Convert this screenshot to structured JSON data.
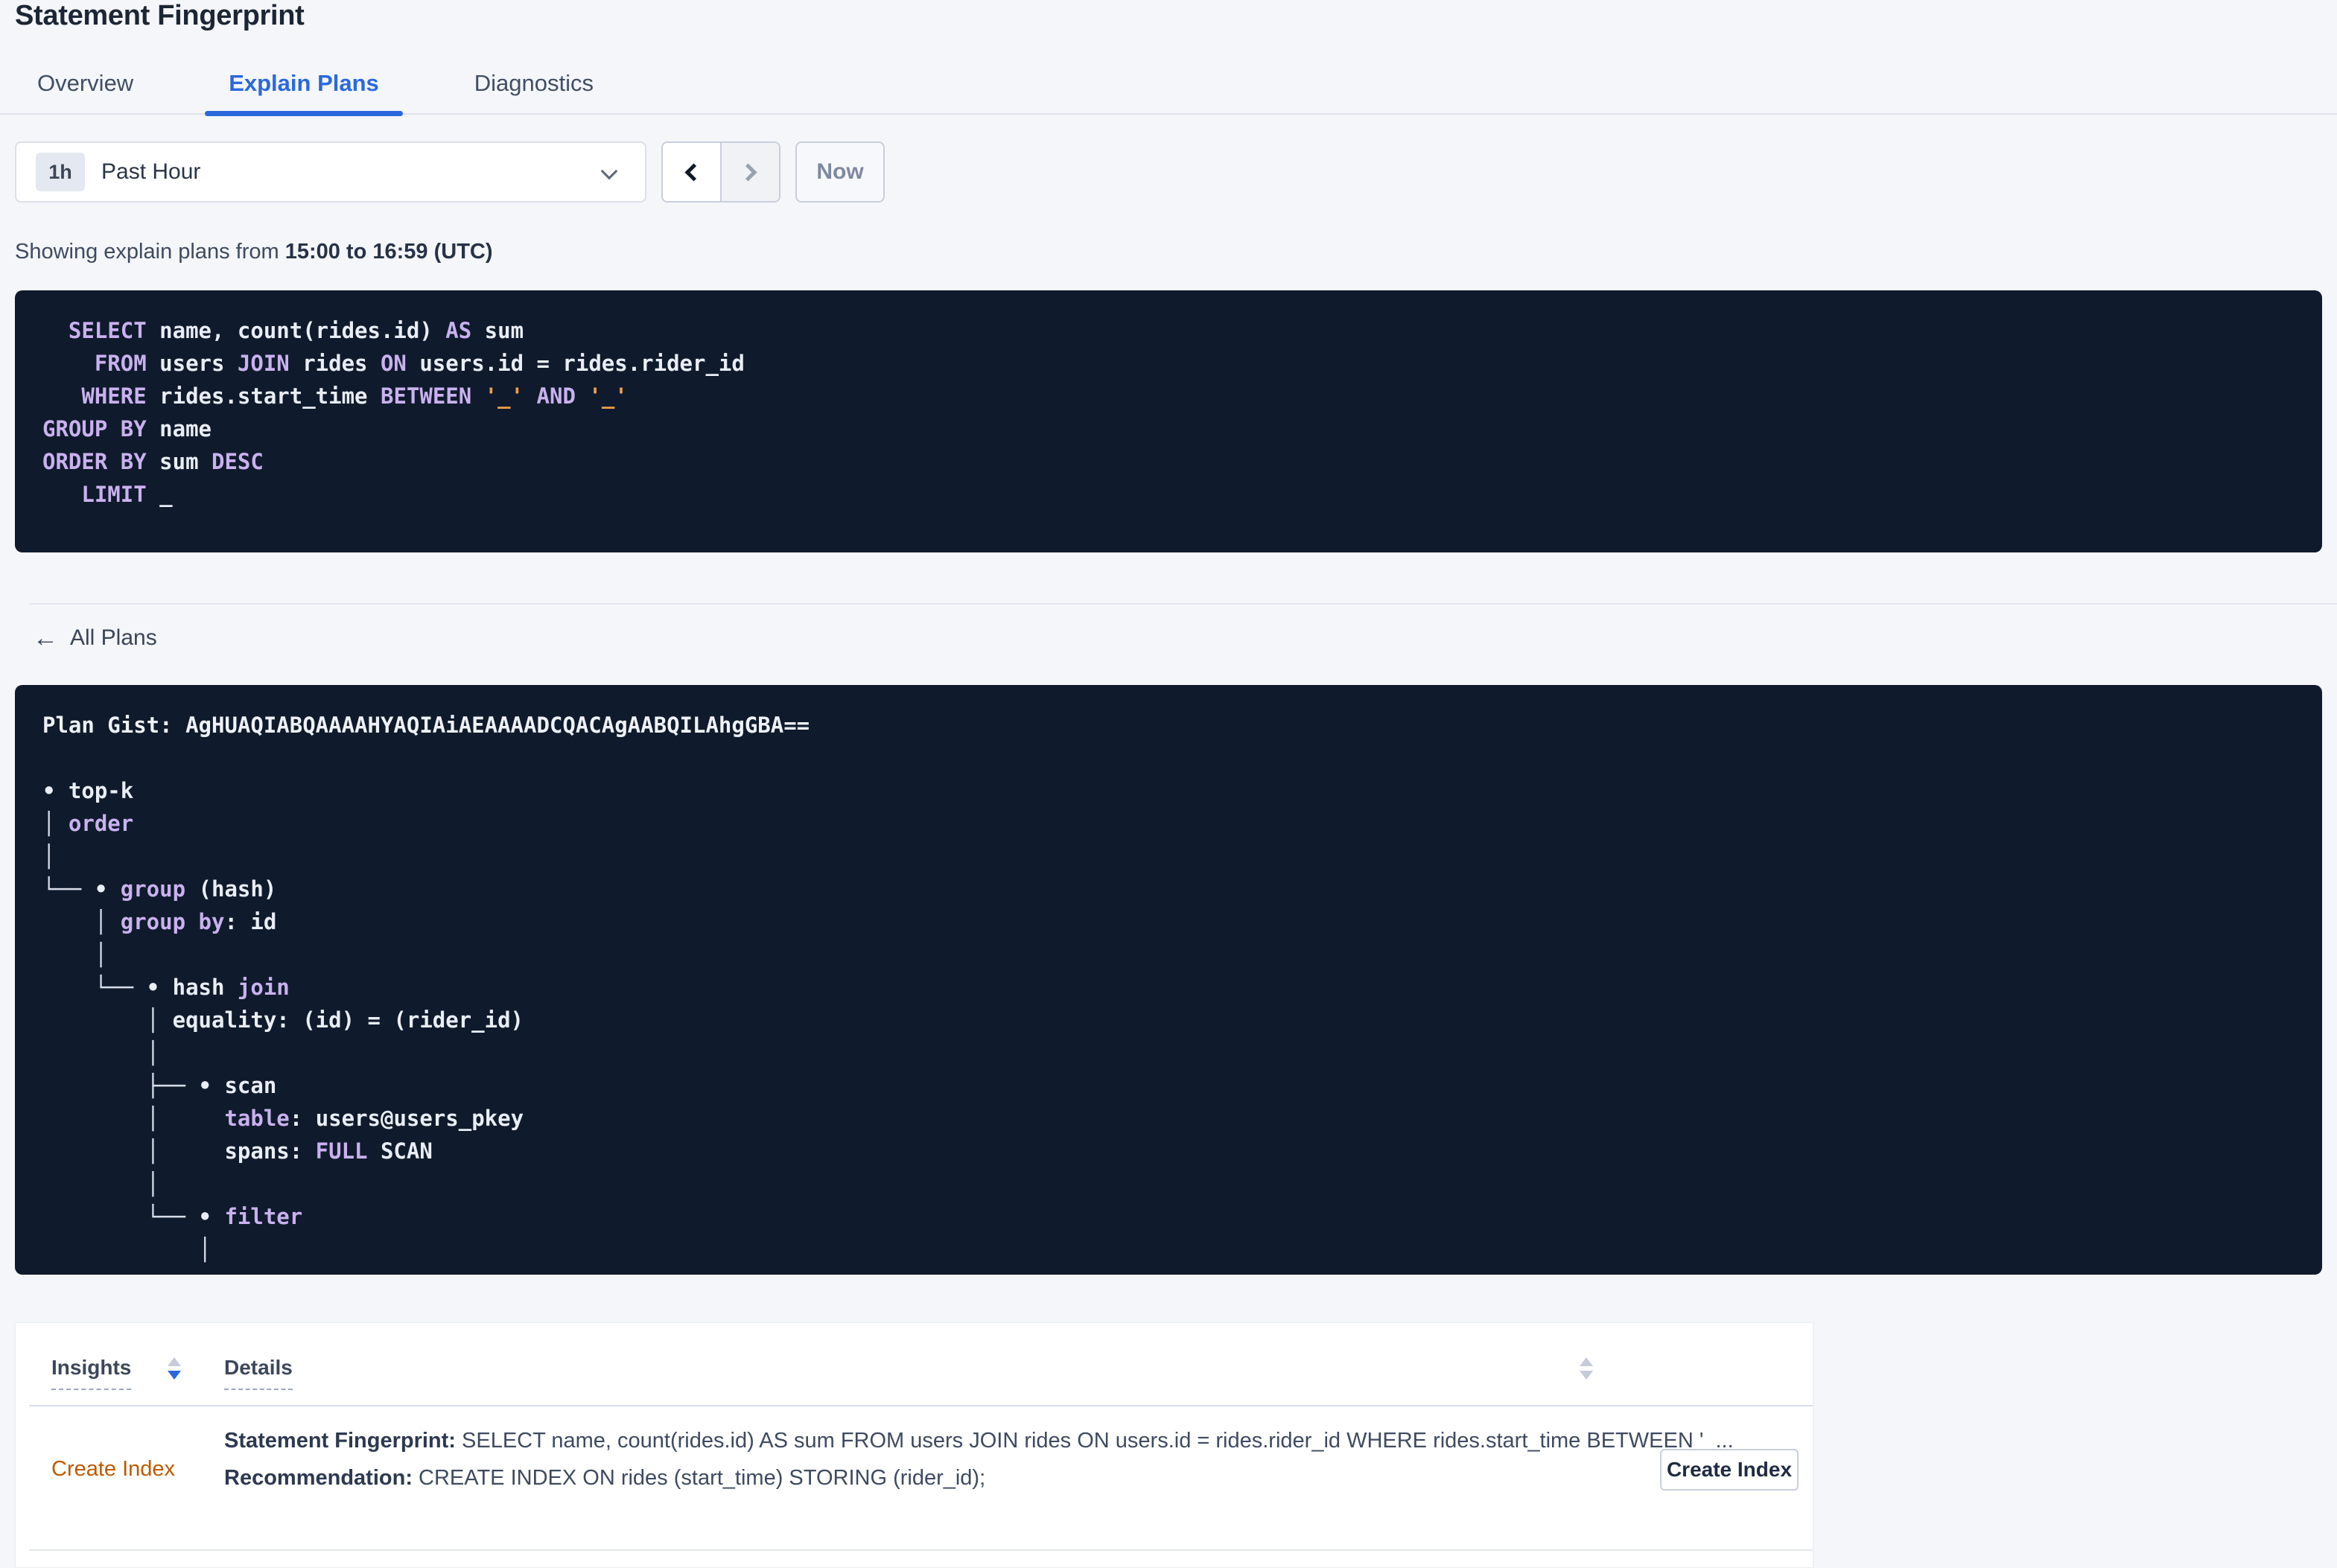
{
  "page": {
    "title": "Statement Fingerprint"
  },
  "tabs": [
    {
      "label": "Overview",
      "active": false
    },
    {
      "label": "Explain Plans",
      "active": true
    },
    {
      "label": "Diagnostics",
      "active": false
    }
  ],
  "time_selector": {
    "badge": "1h",
    "label": "Past Hour",
    "now_label": "Now"
  },
  "icons": {
    "chevron_down": "select-chevron-down",
    "chevron_left": "chevron-left",
    "chevron_right": "chevron-right",
    "back_arrow": "←",
    "sort_asc": "sort-up-triangle",
    "sort_desc": "sort-down-triangle"
  },
  "showing": {
    "prefix": "Showing explain plans from ",
    "range": "15:00 to 16:59 (UTC)"
  },
  "sql": {
    "lines": [
      [
        {
          "t": "  ",
          "c": "tx"
        },
        {
          "t": "SELECT",
          "c": "kw"
        },
        {
          "t": " name, count(rides.id) ",
          "c": "tx"
        },
        {
          "t": "AS",
          "c": "kw"
        },
        {
          "t": " sum",
          "c": "tx"
        }
      ],
      [
        {
          "t": "    ",
          "c": "tx"
        },
        {
          "t": "FROM",
          "c": "kw"
        },
        {
          "t": " users ",
          "c": "tx"
        },
        {
          "t": "JOIN",
          "c": "kw"
        },
        {
          "t": " rides ",
          "c": "tx"
        },
        {
          "t": "ON",
          "c": "kw"
        },
        {
          "t": " users.id = rides.rider_id",
          "c": "tx"
        }
      ],
      [
        {
          "t": "   ",
          "c": "tx"
        },
        {
          "t": "WHERE",
          "c": "kw"
        },
        {
          "t": " rides.start_time ",
          "c": "tx"
        },
        {
          "t": "BETWEEN",
          "c": "kw"
        },
        {
          "t": " ",
          "c": "tx"
        },
        {
          "t": "'_'",
          "c": "lit"
        },
        {
          "t": " ",
          "c": "tx"
        },
        {
          "t": "AND",
          "c": "kw"
        },
        {
          "t": " ",
          "c": "tx"
        },
        {
          "t": "'_'",
          "c": "lit"
        }
      ],
      [
        {
          "t": "GROUP BY",
          "c": "kw"
        },
        {
          "t": " name",
          "c": "tx"
        }
      ],
      [
        {
          "t": "ORDER BY",
          "c": "kw"
        },
        {
          "t": " sum ",
          "c": "tx"
        },
        {
          "t": "DESC",
          "c": "kw"
        }
      ],
      [
        {
          "t": "   ",
          "c": "tx"
        },
        {
          "t": "LIMIT",
          "c": "kw"
        },
        {
          "t": " _",
          "c": "tx"
        }
      ]
    ]
  },
  "all_plans": {
    "label": "All Plans"
  },
  "plan": {
    "gist_label": "Plan Gist: ",
    "gist": "AgHUAQIABQAAAAHYAQIAiAEAAAADCQACAgAABQILAhgGBA==",
    "tree_lines": [
      [
        {
          "t": "• top-k",
          "c": "tx"
        }
      ],
      [
        {
          "t": "│ ",
          "c": "br"
        },
        {
          "t": "order",
          "c": "kw"
        }
      ],
      [
        {
          "t": "│",
          "c": "br"
        }
      ],
      [
        {
          "t": "└── ",
          "c": "br"
        },
        {
          "t": "• ",
          "c": "tx"
        },
        {
          "t": "group",
          "c": "kw"
        },
        {
          "t": " (hash)",
          "c": "tx"
        }
      ],
      [
        {
          "t": "    ",
          "c": "tx"
        },
        {
          "t": "│ ",
          "c": "br"
        },
        {
          "t": "group by",
          "c": "kw"
        },
        {
          "t": ": id",
          "c": "tx"
        }
      ],
      [
        {
          "t": "    ",
          "c": "tx"
        },
        {
          "t": "│",
          "c": "br"
        }
      ],
      [
        {
          "t": "    ",
          "c": "tx"
        },
        {
          "t": "└── ",
          "c": "br"
        },
        {
          "t": "• hash ",
          "c": "tx"
        },
        {
          "t": "join",
          "c": "kw"
        }
      ],
      [
        {
          "t": "        ",
          "c": "tx"
        },
        {
          "t": "│ ",
          "c": "br"
        },
        {
          "t": "equality: (id) = (rider_id)",
          "c": "tx"
        }
      ],
      [
        {
          "t": "        ",
          "c": "tx"
        },
        {
          "t": "│",
          "c": "br"
        }
      ],
      [
        {
          "t": "        ",
          "c": "tx"
        },
        {
          "t": "├── ",
          "c": "br"
        },
        {
          "t": "• scan",
          "c": "tx"
        }
      ],
      [
        {
          "t": "        ",
          "c": "tx"
        },
        {
          "t": "│",
          "c": "br"
        },
        {
          "t": "     ",
          "c": "tx"
        },
        {
          "t": "table",
          "c": "kw"
        },
        {
          "t": ": users@users_pkey",
          "c": "tx"
        }
      ],
      [
        {
          "t": "        ",
          "c": "tx"
        },
        {
          "t": "│",
          "c": "br"
        },
        {
          "t": "     spans: ",
          "c": "tx"
        },
        {
          "t": "FULL",
          "c": "kw"
        },
        {
          "t": " SCAN",
          "c": "tx"
        }
      ],
      [
        {
          "t": "        ",
          "c": "tx"
        },
        {
          "t": "│",
          "c": "br"
        }
      ],
      [
        {
          "t": "        ",
          "c": "tx"
        },
        {
          "t": "└── ",
          "c": "br"
        },
        {
          "t": "• ",
          "c": "tx"
        },
        {
          "t": "filter",
          "c": "kw"
        }
      ],
      [
        {
          "t": "            ",
          "c": "tx"
        },
        {
          "t": "│",
          "c": "br"
        }
      ]
    ]
  },
  "insights_table": {
    "headers": {
      "insights": "Insights",
      "details": "Details"
    },
    "row": {
      "insight": "Create Index",
      "detail1_label": "Statement Fingerprint:",
      "detail1_text": " SELECT name, count(rides.id) AS sum FROM users JOIN rides ON users.id = rides.rider_id WHERE rides.start_time BETWEEN '_...",
      "detail2_label": "Recommendation:",
      "detail2_text": " CREATE INDEX ON rides (start_time) STORING (rider_id);",
      "button": "Create Index"
    }
  },
  "colors": {
    "accent_blue": "#2b68dd",
    "code_background": "#0f1a2c",
    "sql_keyword": "#c9b1ee",
    "sql_literal": "#f0a04a",
    "insight_link": "#bd5a00",
    "page_background": "#f4f6fa"
  }
}
